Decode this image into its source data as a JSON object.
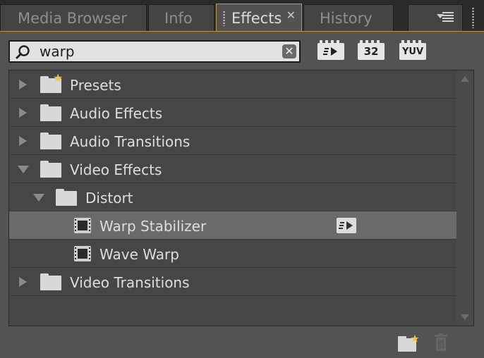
{
  "tabs": [
    {
      "label": "Media Browser",
      "active": false
    },
    {
      "label": "Info",
      "active": false
    },
    {
      "label": "Effects",
      "active": true
    },
    {
      "label": "History",
      "active": false
    }
  ],
  "search": {
    "value": "warp",
    "placeholder": ""
  },
  "filters": {
    "accelerated": "",
    "bit32": "32",
    "yuv": "YUV"
  },
  "tree": {
    "presets": "Presets",
    "audio_effects": "Audio Effects",
    "audio_transitions": "Audio Transitions",
    "video_effects": "Video Effects",
    "distort": "Distort",
    "warp_stabilizer": "Warp Stabilizer",
    "wave_warp": "Wave Warp",
    "video_transitions": "Video Transitions"
  },
  "colors": {
    "accent": "#c19a3f",
    "panel": "#535353",
    "selected": "#6a6a6a"
  }
}
